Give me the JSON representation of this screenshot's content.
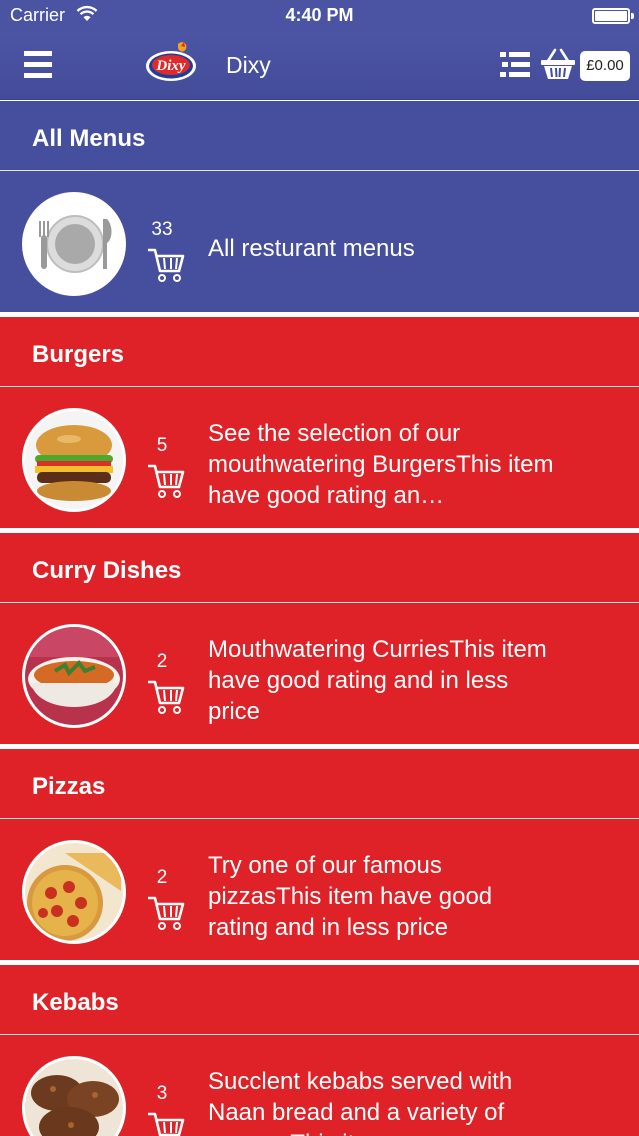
{
  "status_bar": {
    "carrier": "Carrier",
    "time": "4:40 PM"
  },
  "nav": {
    "title": "Dixy",
    "logo_text": "Dixy",
    "basket_total": "£0.00"
  },
  "sections": [
    {
      "title": "All Menus",
      "count": "33",
      "description": "All resturant menus",
      "image": "plate-icon"
    },
    {
      "title": "Burgers",
      "count": "5",
      "description": "See the selection of our mouthwatering BurgersThis item have good rating an…",
      "image": "burger-photo"
    },
    {
      "title": "Curry Dishes",
      "count": "2",
      "description": "Mouthwatering CurriesThis item have good rating and in less price",
      "image": "curry-photo"
    },
    {
      "title": "Pizzas",
      "count": "2",
      "description": "Try one of our famous pizzasThis item have good rating and in less price",
      "image": "pizza-photo"
    },
    {
      "title": "Kebabs",
      "count": "3",
      "description": "Succlent kebabs served with Naan bread and a variety of sauces This it",
      "image": "kebab-photo"
    }
  ],
  "colors": {
    "nav_blue": "#4a54a3",
    "section_blue": "#464f9e",
    "section_red": "#de2227"
  }
}
